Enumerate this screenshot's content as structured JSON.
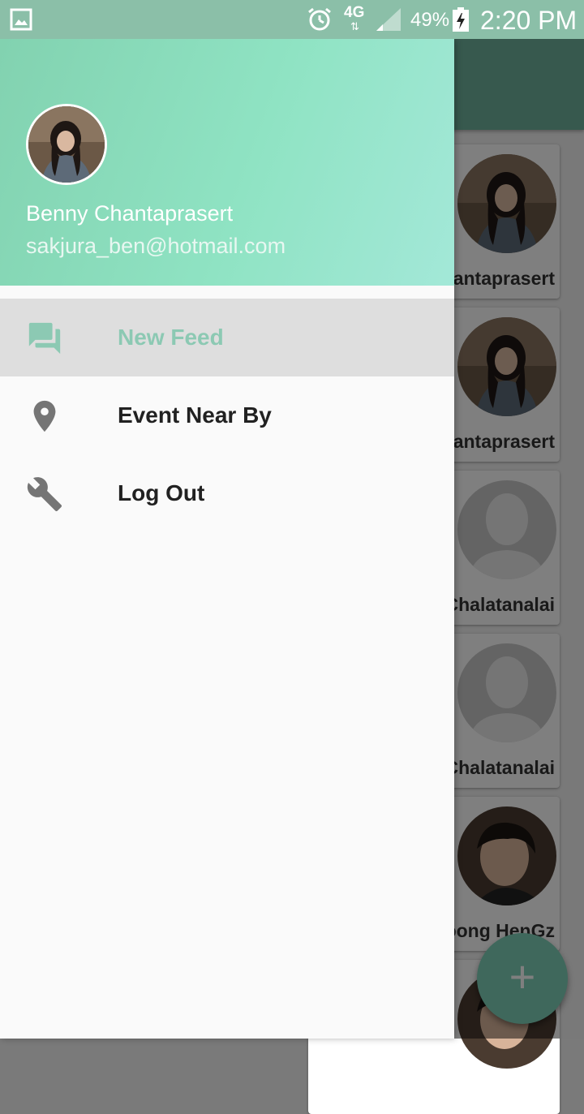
{
  "status_bar": {
    "network": "4G",
    "network_arrows": "⇅",
    "battery_percent": "49%",
    "time": "2:20 PM",
    "icons": [
      "gallery-icon",
      "alarm-icon",
      "signal-icon",
      "battery-charging-icon"
    ]
  },
  "drawer": {
    "profile": {
      "name": "Benny Chantaprasert",
      "email": "sakjura_ben@hotmail.com"
    },
    "items": [
      {
        "label": "New Feed",
        "icon": "forum-icon",
        "active": true
      },
      {
        "label": "Event Near By",
        "icon": "location-pin-icon",
        "active": false
      },
      {
        "label": "Log Out",
        "icon": "wrench-icon",
        "active": false
      }
    ]
  },
  "feed": {
    "cards": [
      {
        "name": "antaprasert",
        "avatar": "photo-girl"
      },
      {
        "name": "antaprasert",
        "avatar": "photo-girl"
      },
      {
        "name": "Chalatanalai",
        "avatar": "placeholder"
      },
      {
        "name": "Chalatanalai",
        "avatar": "placeholder"
      },
      {
        "name": "oong HenGz",
        "avatar": "photo-boy"
      }
    ],
    "fab_label": "+"
  },
  "colors": {
    "accent": "#8cc9b3",
    "header_start": "#82d2b0",
    "header_end": "#a3e8d8",
    "appbar": "#6fb29d",
    "fab": "#7fd1b9"
  }
}
